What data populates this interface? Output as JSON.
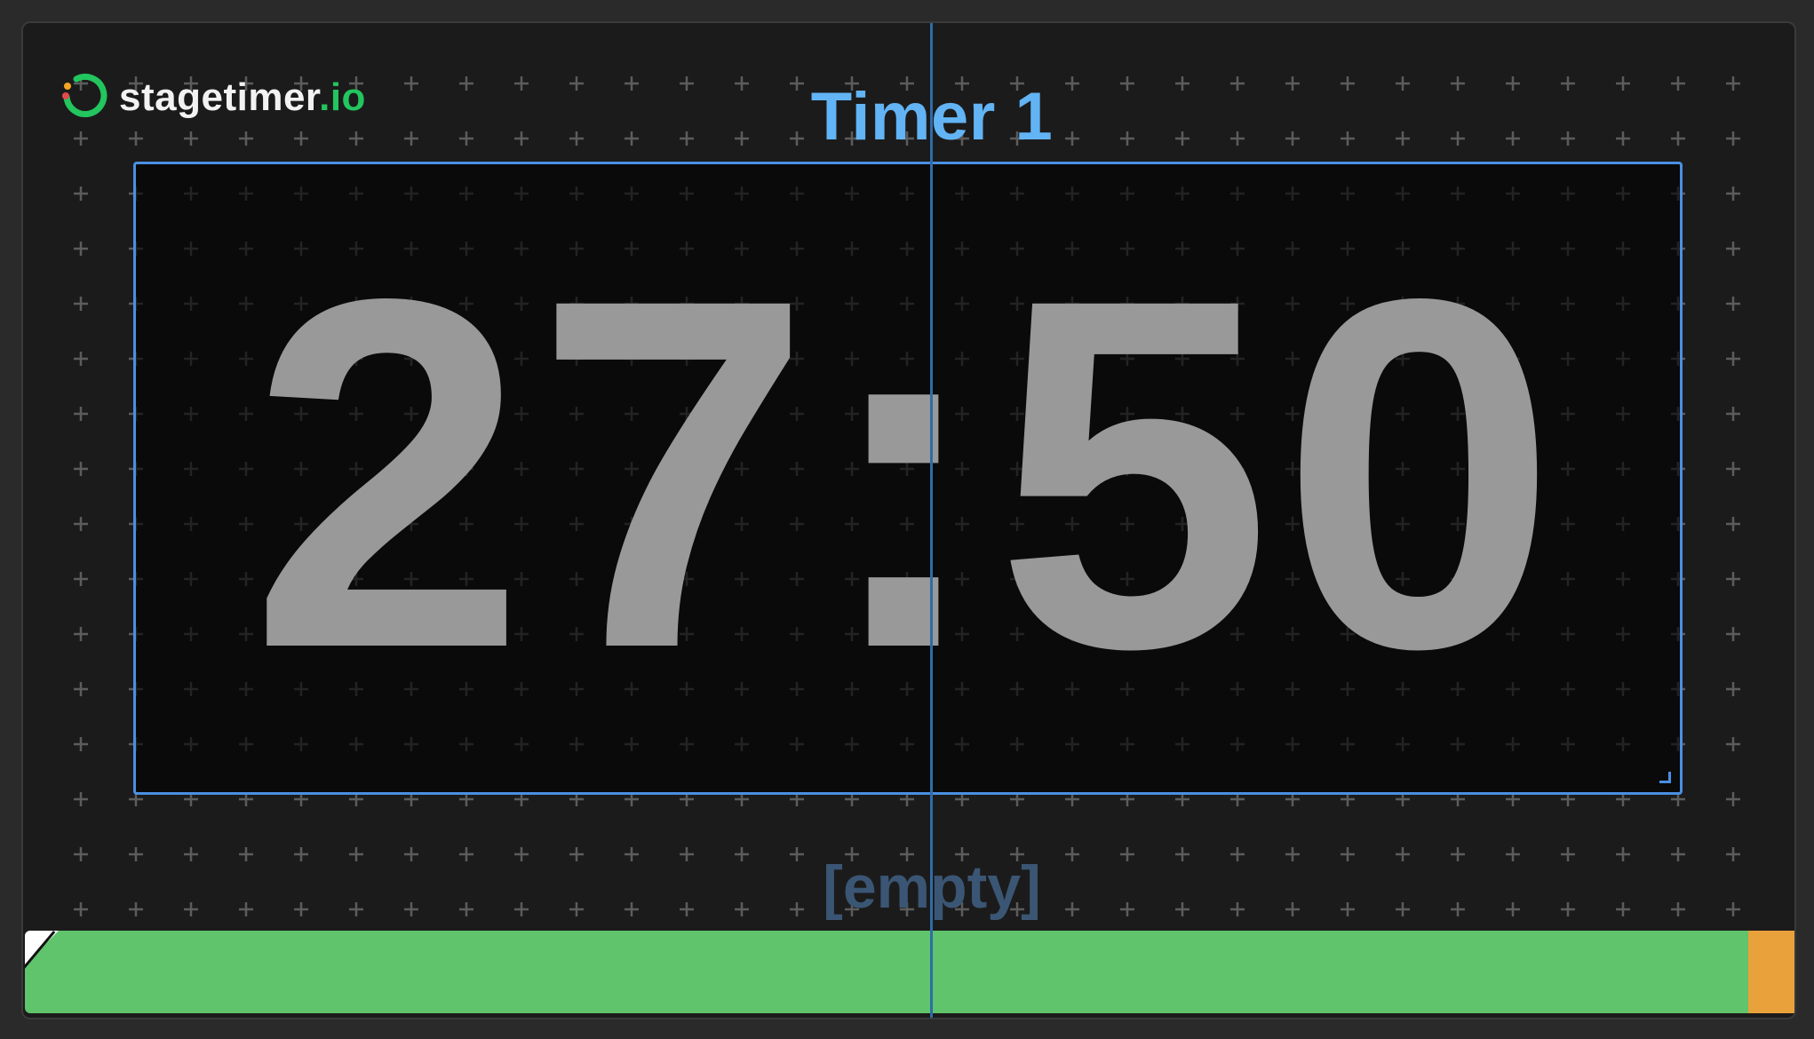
{
  "app": {
    "logo_name": "stagetimer",
    "logo_tld": ".io",
    "timer_title": "Timer 1",
    "time_display": "27:50",
    "message": "[empty]"
  },
  "progress": {
    "elapsed_fraction": 0.0,
    "warning_start_fraction": 0.964,
    "danger_start_fraction": 0.991
  },
  "colors": {
    "accent": "#4a90e2",
    "title": "#62b4f4",
    "digits": "#999999",
    "progress_green": "#5fc46b",
    "progress_orange": "#e9a13b",
    "progress_red": "#e24b4b",
    "logo_green": "#22c55e"
  },
  "icons": {
    "logo": "stagetimer-ring-icon",
    "grid": "plus-grid-pattern"
  }
}
